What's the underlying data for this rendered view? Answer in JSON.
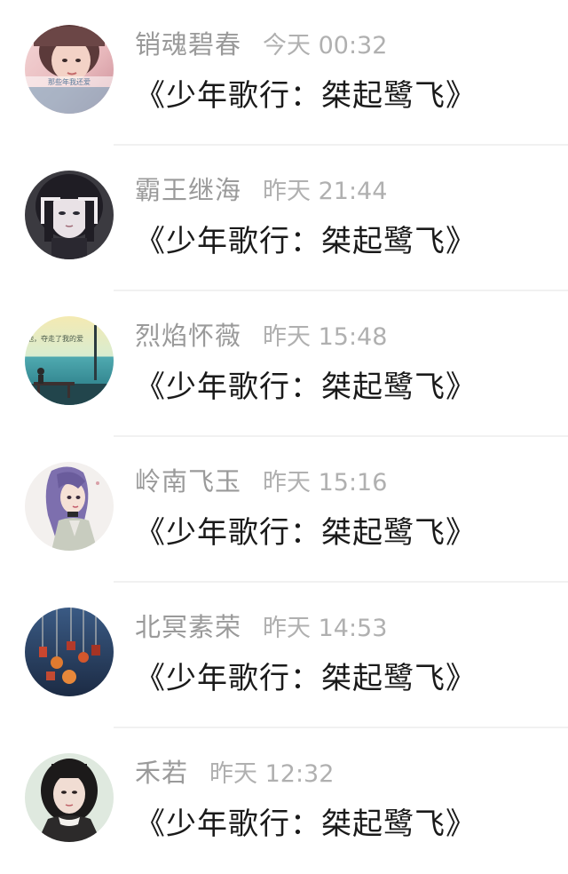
{
  "comments": [
    {
      "name": "销魂碧春",
      "time": "今天 00:32",
      "text": "《少年歌行：桀起鹭飞》",
      "avatar": "avatar-girl-pink-photo",
      "avatar_caption": "那些年我还爱"
    },
    {
      "name": "霸王继海",
      "time": "昨天 21:44",
      "text": "《少年歌行：桀起鹭飞》",
      "avatar": "avatar-anime-dark-hair"
    },
    {
      "name": "烈焰怀薇",
      "time": "昨天 15:48",
      "text": "《少年歌行：桀起鹭飞》",
      "avatar": "avatar-seaside-scene",
      "avatar_caption": "他，夺走了我的爱"
    },
    {
      "name": "岭南飞玉",
      "time": "昨天 15:16",
      "text": "《少年歌行：桀起鹭飞》",
      "avatar": "avatar-anime-purple-hair"
    },
    {
      "name": "北冥素荣",
      "time": "昨天 14:53",
      "text": "《少年歌行：桀起鹭飞》",
      "avatar": "avatar-hanging-charms"
    },
    {
      "name": "禾若",
      "time": "昨天 12:32",
      "text": "《少年歌行：桀起鹭飞》",
      "avatar": "avatar-girl-portrait"
    }
  ]
}
